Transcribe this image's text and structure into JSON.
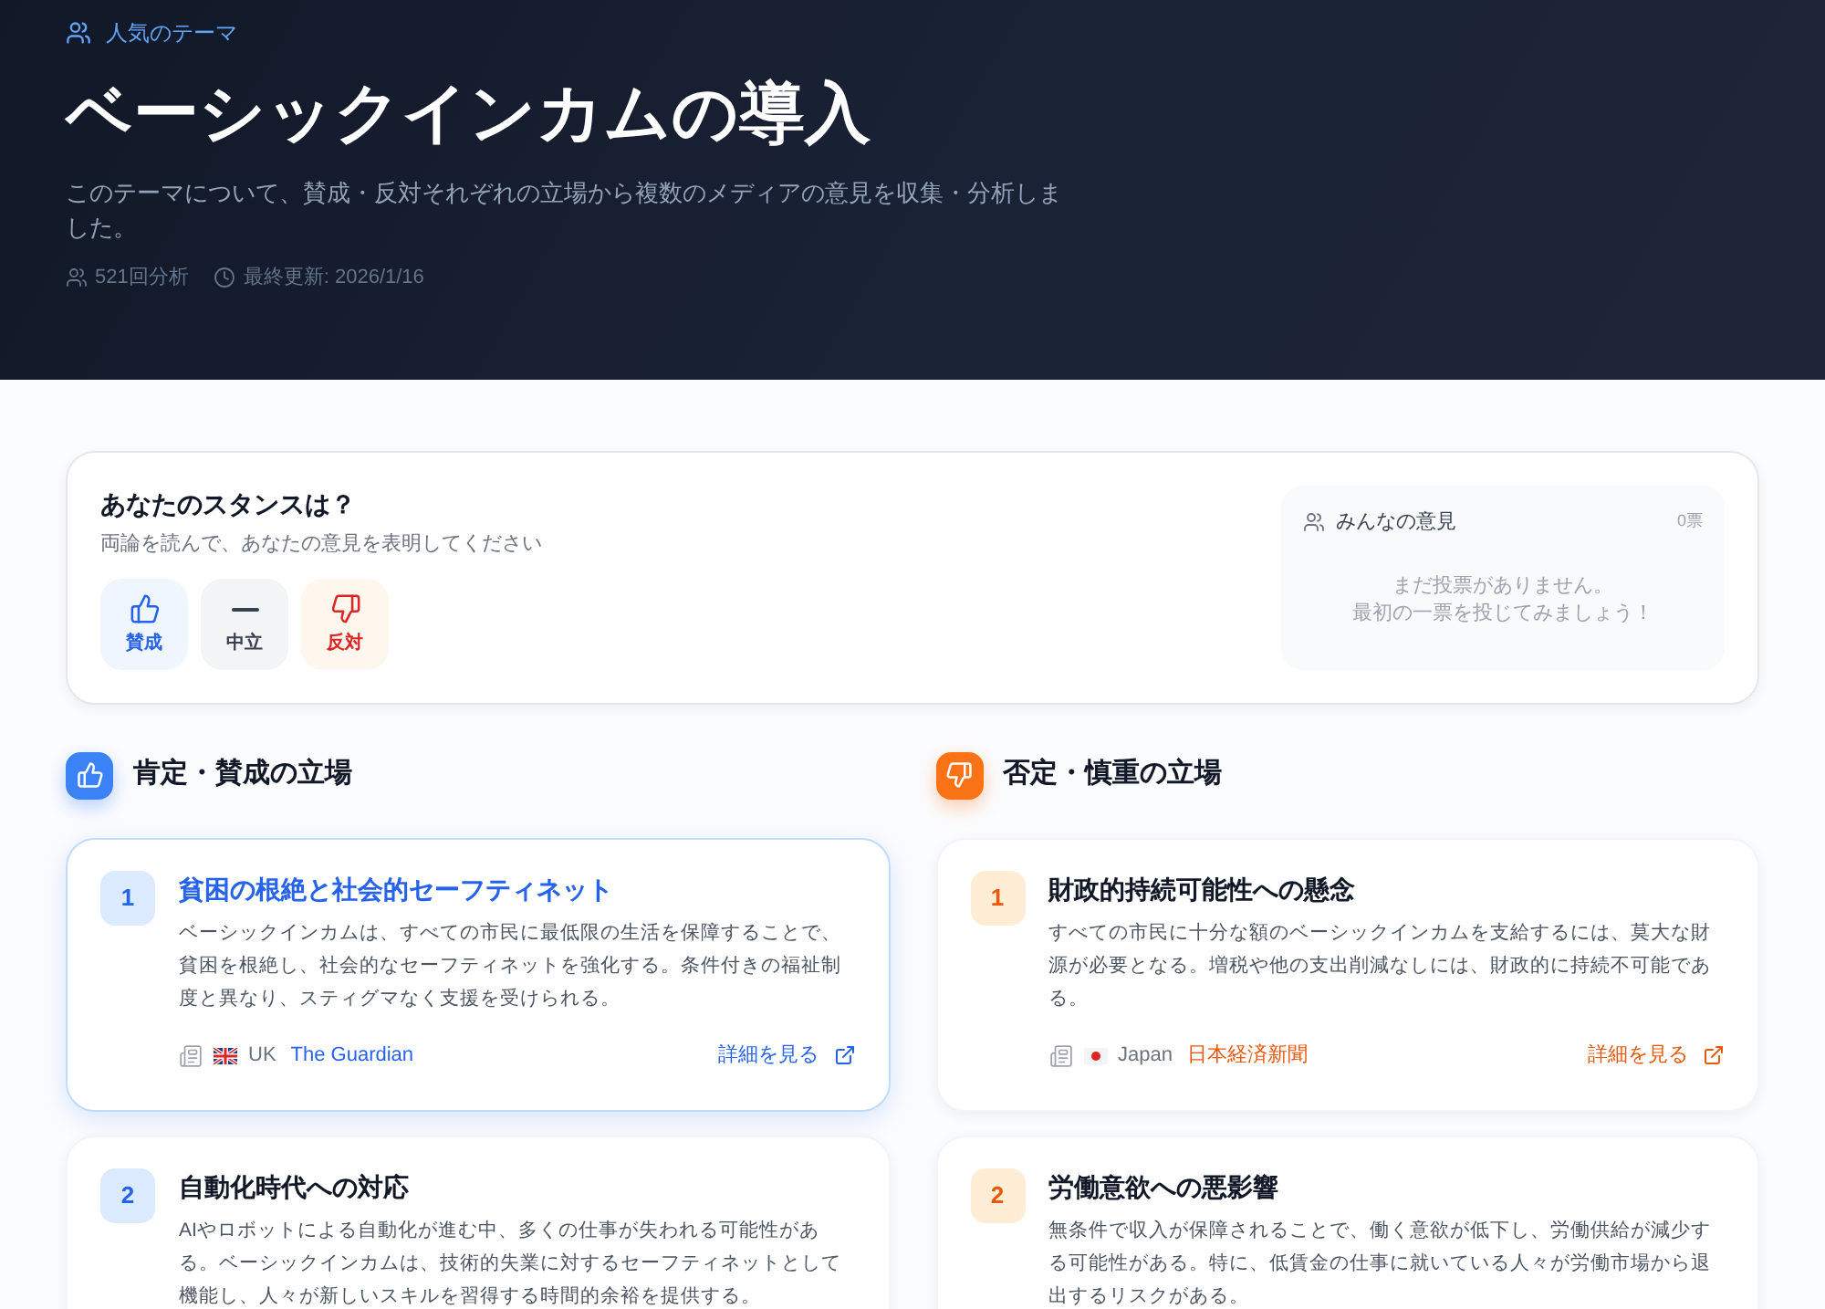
{
  "hero": {
    "category": "人気のテーマ",
    "title": "ベーシックインカムの導入",
    "description": "このテーマについて、賛成・反対それぞれの立場から複数のメディアの意見を収集・分析しました。",
    "meta": [
      {
        "kind": "count",
        "text": "521回分析"
      },
      {
        "kind": "updated",
        "text": "最終更新: 2026/1/16"
      }
    ]
  },
  "stance": {
    "title": "あなたのスタンスは？",
    "subtitle": "両論を読んで、あなたの意見を表明してください",
    "options": [
      {
        "kind": "agree",
        "label": "賛成",
        "selected": false
      },
      {
        "kind": "neutral",
        "label": "中立",
        "selected": false
      },
      {
        "kind": "disagree",
        "label": "反対",
        "selected": false
      }
    ],
    "results": {
      "title": "みんなの意見",
      "count": "0票",
      "empty_message": [
        "まだ投票がありません。",
        "最初の一票を投じてみましょう！"
      ]
    }
  },
  "columns": [
    {
      "kind": "pro",
      "heading": "肯定・賛成の立場",
      "arguments": [
        {
          "number": "1",
          "title": "貧困の根絶と社会的セーフティネット",
          "body": "ベーシックインカムは、すべての市民に最低限の生活を保障することで、貧困を根絶し、社会的なセーフティネットを強化する。条件付きの福祉制度と異なり、スティグマなく支援を受けられる。",
          "selected": true,
          "source": {
            "kind": "uk",
            "country": "UK",
            "name": "The Guardian"
          },
          "link": "詳細を見る"
        },
        {
          "number": "2",
          "title": "自動化時代への対応",
          "body": "AIやロボットによる自動化が進む中、多くの仕事が失われる可能性がある。ベーシックインカムは、技術的失業に対するセーフティネットとして機能し、人々が新しいスキルを習得する時間的余裕を提供する。",
          "selected": false
        }
      ]
    },
    {
      "kind": "con",
      "heading": "否定・慎重の立場",
      "arguments": [
        {
          "number": "1",
          "title": "財政的持続可能性への懸念",
          "body": "すべての市民に十分な額のベーシックインカムを支給するには、莫大な財源が必要となる。増税や他の支出削減なしには、財政的に持続不可能である。",
          "selected": false,
          "source": {
            "kind": "jp",
            "country": "Japan",
            "name": "日本経済新聞"
          },
          "link": "詳細を見る"
        },
        {
          "number": "2",
          "title": "労働意欲への悪影響",
          "body": "無条件で収入が保障されることで、働く意欲が低下し、労働供給が減少する可能性がある。特に、低賃金の仕事に就いている人々が労働市場から退出するリスクがある。",
          "selected": false
        }
      ]
    }
  ]
}
